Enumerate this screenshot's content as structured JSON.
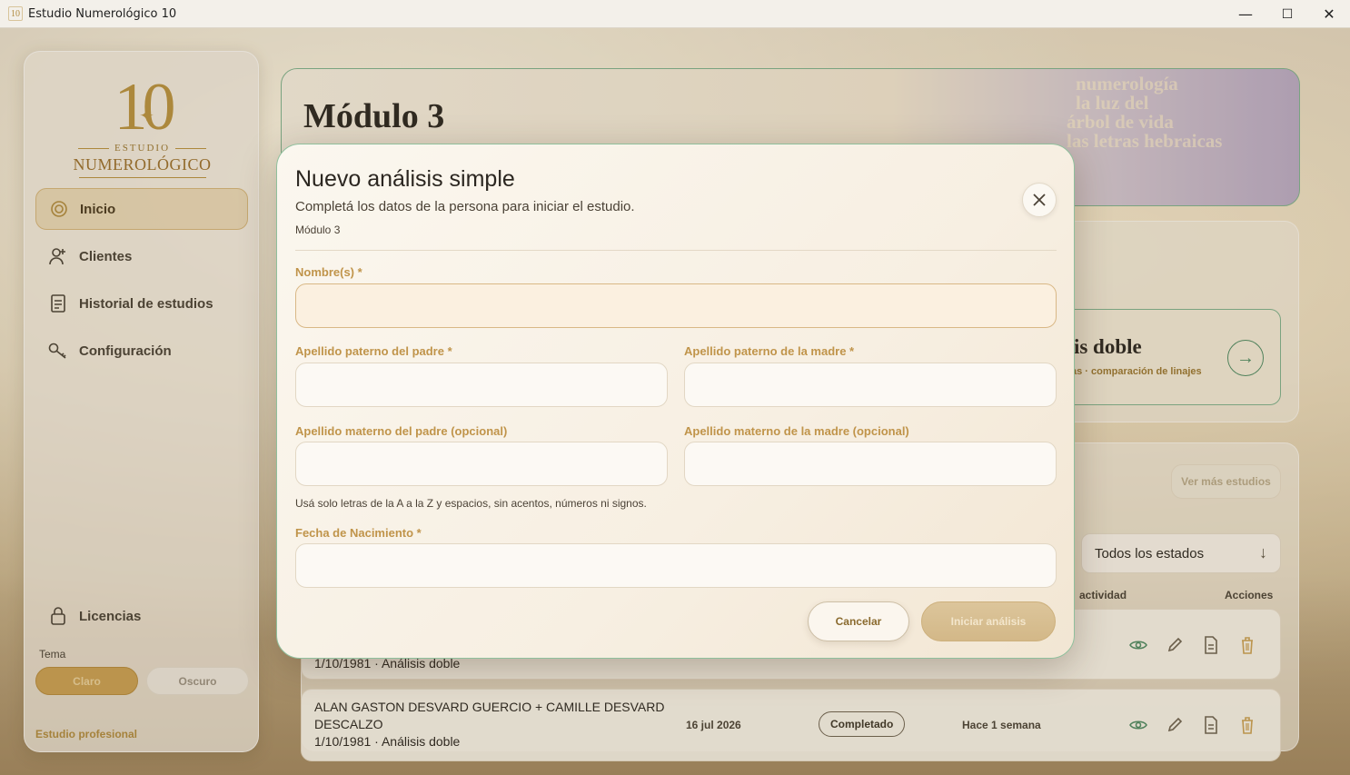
{
  "window": {
    "title": "Estudio Numerológico 10",
    "icon_text": "10",
    "minimize": "—",
    "maximize": "☐",
    "close": "✕"
  },
  "sidebar": {
    "logo_number": "10",
    "logo_line1": "ESTUDIO",
    "logo_line2": "NUMEROLÓGICO",
    "items": [
      {
        "label": "Inicio",
        "icon": "home-icon",
        "active": true
      },
      {
        "label": "Clientes",
        "icon": "clients-icon"
      },
      {
        "label": "Historial de estudios",
        "icon": "history-icon"
      },
      {
        "label": "Configuración",
        "icon": "key-icon"
      }
    ],
    "licencias": "Licencias",
    "tema_label": "Tema",
    "theme_light": "Claro",
    "theme_dark": "Oscuro",
    "footer": "Estudio profesional"
  },
  "main": {
    "hero_title": "Módulo 3",
    "hero_side": [
      "numerología",
      "la luz del",
      "árbol de vida",
      "las letras hebraicas"
    ],
    "double_card": {
      "title": "sis doble",
      "subtitle": "as · comparación de linajes"
    },
    "ver_mas": "Ver más estudios",
    "estado_select": "Todos los estados",
    "col_activity": "actividad",
    "col_actions": "Acciones",
    "rows": [
      {
        "name_tail": "1/10/1981 · Análisis doble"
      },
      {
        "name_line1": "ALAN GASTON DESVARD GUERCIO + CAMILLE DESVARD",
        "name_line2": "DESCALZO",
        "name_line3": "1/10/1981 · Análisis doble",
        "date": "16 jul 2026",
        "status": "Completado",
        "activity": "Hace 1 semana"
      }
    ]
  },
  "modal": {
    "title": "Nuevo análisis simple",
    "subtitle": "Completá los datos de la persona para iniciar el estudio.",
    "module": "Módulo 3",
    "fields": {
      "nombres": {
        "label": "Nombre(s) *",
        "value": ""
      },
      "ap_padre": {
        "label": "Apellido paterno del padre *",
        "value": ""
      },
      "ap_madre": {
        "label": "Apellido paterno de la madre *",
        "value": ""
      },
      "am_padre": {
        "label": "Apellido materno del padre (opcional)",
        "value": ""
      },
      "am_madre": {
        "label": "Apellido materno de la madre (opcional)",
        "value": ""
      },
      "fecha": {
        "label": "Fecha de Nacimiento *",
        "value": ""
      }
    },
    "hint": "Usá solo letras de la A a la Z y espacios, sin acentos, números ni signos.",
    "cancel": "Cancelar",
    "start": "Iniciar análisis"
  },
  "colors": {
    "accent_gold": "#c0944a",
    "accent_green": "#7fb08c",
    "text_dark": "#2b2620"
  }
}
